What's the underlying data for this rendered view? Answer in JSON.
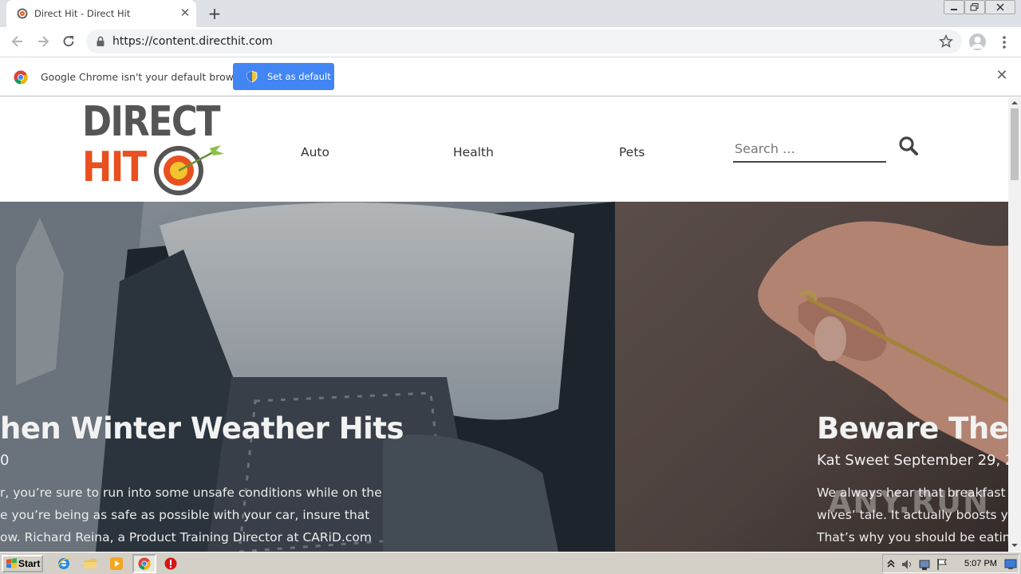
{
  "browser": {
    "tab": {
      "title": "Direct Hit - Direct Hit"
    },
    "url": "https://content.directhit.com",
    "infobar": {
      "message": "Google Chrome isn't your default browser",
      "button_label": "Set as default"
    }
  },
  "site": {
    "logo": {
      "line1": "DIRECT",
      "line2": "HIT"
    },
    "nav": [
      {
        "label": "Auto"
      },
      {
        "label": "Health"
      },
      {
        "label": "Pets"
      }
    ],
    "search": {
      "placeholder": "Search …"
    }
  },
  "articles": [
    {
      "title": "hen Winter Weather Hits",
      "meta": "0",
      "excerpt": [
        "r, you’re sure to run into some unsafe conditions while on the",
        "e you’re being as safe as possible with your car, insure that",
        "ow. Richard Reina, a Product Training Director at CARiD.com"
      ]
    },
    {
      "title": "Beware These",
      "meta": "Kat Sweet September 29, 2",
      "excerpt": [
        "We always hear that breakfast",
        "wives’ tale. It actually boosts y",
        "That’s why you should be eatin"
      ]
    }
  ],
  "watermark": "ANY.RUN",
  "taskbar": {
    "start_label": "Start",
    "clock": "5:07 PM"
  },
  "colors": {
    "chrome_blue": "#4285f4",
    "logo_gray": "#555555",
    "logo_orange": "#e8501f"
  }
}
